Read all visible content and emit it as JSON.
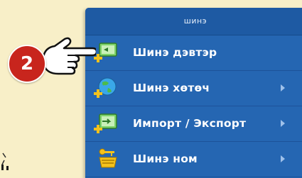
{
  "menu": {
    "header": "шинэ",
    "items": [
      {
        "label": "Шинэ дэвтэр",
        "icon": "new-notebook-icon",
        "has_submenu": false
      },
      {
        "label": "Шинэ хөтөч",
        "icon": "new-globe-icon",
        "has_submenu": true
      },
      {
        "label": "Импорт / Экспорт",
        "icon": "import-export-icon",
        "has_submenu": true
      },
      {
        "label": "Шинэ ном",
        "icon": "new-book-icon",
        "has_submenu": true
      }
    ]
  },
  "annotation": {
    "step_number": "2",
    "pointer_icon": "pointing-hand-icon"
  },
  "colors": {
    "background": "#f8efc8",
    "menu": "#2566b2",
    "badge": "#c8251d"
  }
}
